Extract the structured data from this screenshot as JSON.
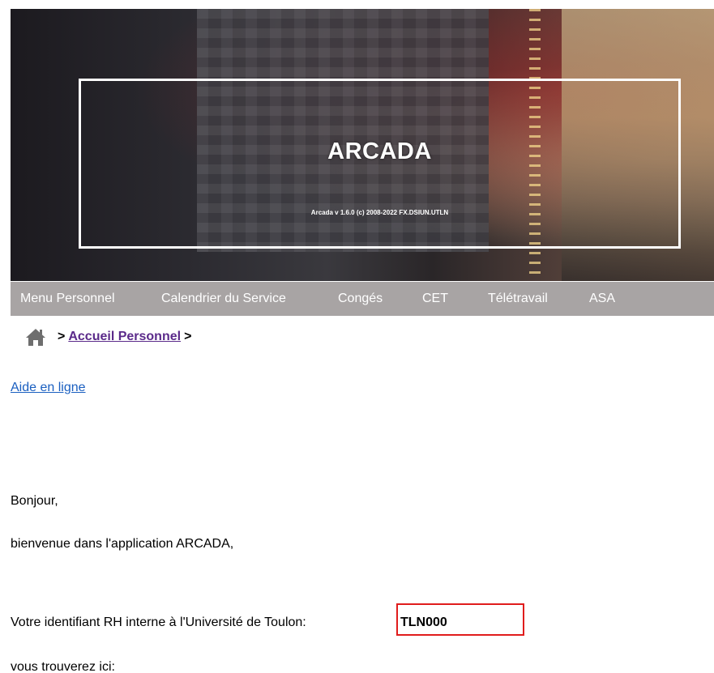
{
  "banner": {
    "title": "ARCADA",
    "version": "Arcada v 1.6.0 (c) 2008-2022 FX.DSIUN.UTLN"
  },
  "nav": {
    "items": [
      {
        "label": "Menu Personnel"
      },
      {
        "label": "Calendrier du Service"
      },
      {
        "label": "Congés"
      },
      {
        "label": "CET"
      },
      {
        "label": "Télétravail"
      },
      {
        "label": "ASA"
      }
    ]
  },
  "breadcrumb": {
    "icon": "home-icon",
    "separator_before": ">",
    "link": "Accueil Personnel",
    "separator_after": ">"
  },
  "help_link": "Aide en ligne",
  "content": {
    "greeting": "Bonjour,",
    "welcome": "bienvenue dans l'application ARCADA,",
    "identifier_label": "Votre identifiant RH interne à l'Université de Toulon:",
    "identifier_value": "TLN000",
    "found_here": "vous trouverez ici:"
  },
  "colors": {
    "nav_bg": "#a8a4a4",
    "link_visited": "#5b2a8a",
    "link": "#1a5fc0",
    "highlight_border": "#e01c1c"
  }
}
